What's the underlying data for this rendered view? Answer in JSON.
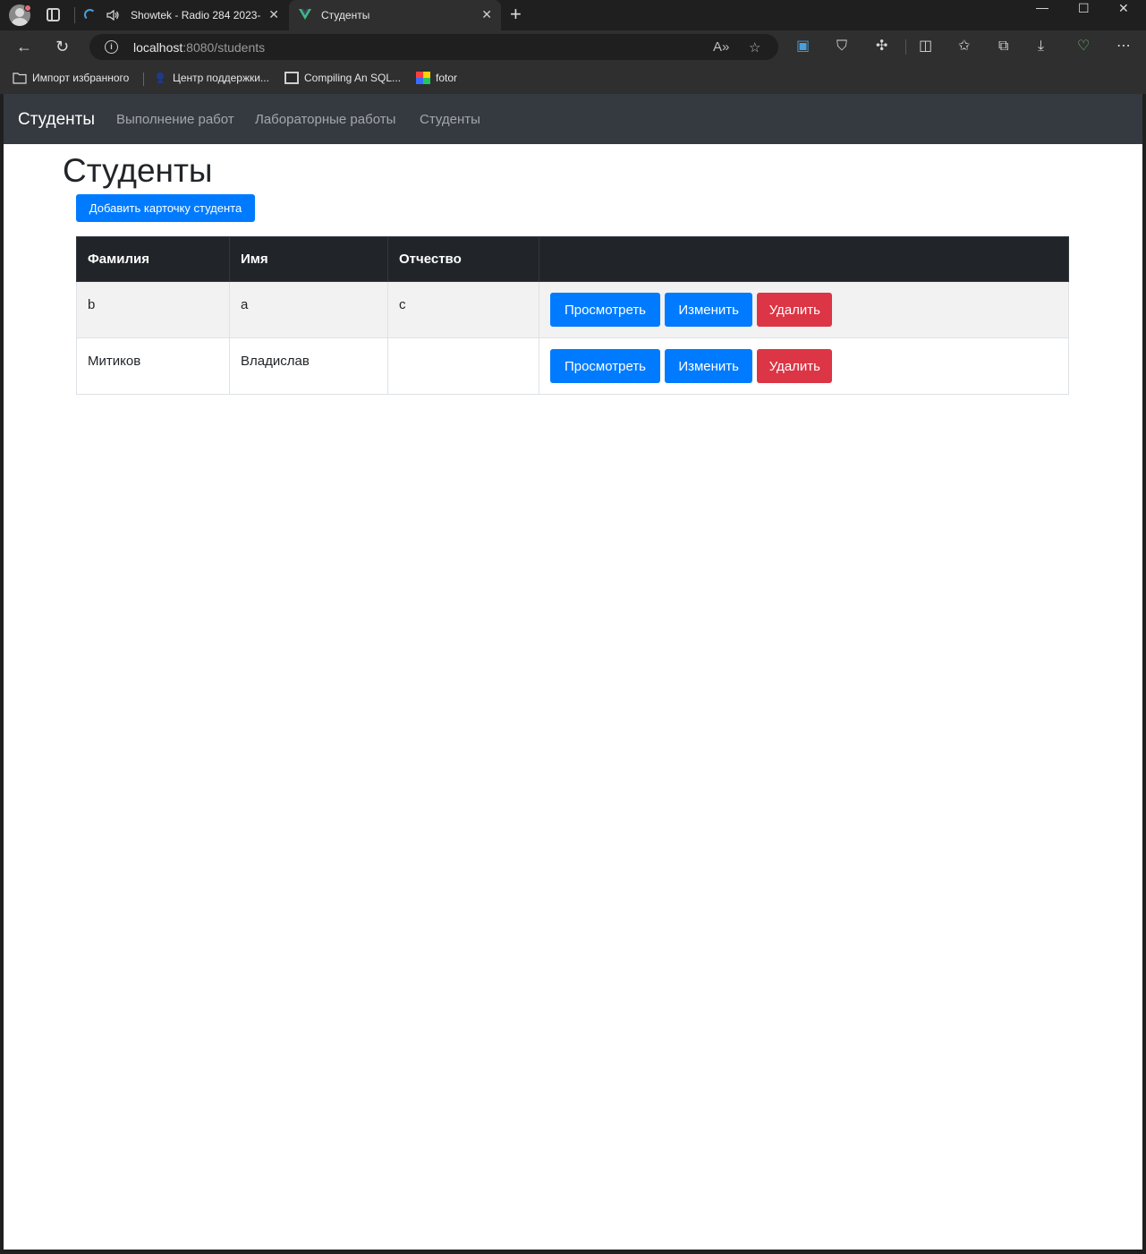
{
  "browser": {
    "tabs": [
      {
        "title": "Showtek - Radio 284 2023-",
        "active": false
      },
      {
        "title": "Студенты",
        "active": true
      }
    ],
    "address": {
      "host": "localhost",
      "rest": ":8080/students"
    },
    "favorites": [
      {
        "label": "Импорт избранного",
        "icon": "folder-import-icon"
      },
      {
        "label": "Центр поддержки...",
        "icon": "support-icon"
      },
      {
        "label": "Compiling An SQL...",
        "icon": "sql-icon"
      },
      {
        "label": "fotor",
        "icon": "fotor-icon"
      }
    ]
  },
  "navbar": {
    "brand": "Студенты",
    "links": [
      "Выполнение работ",
      "Лабораторные работы",
      "Студенты"
    ]
  },
  "page": {
    "title": "Студенты",
    "add_button": "Добавить карточку студента"
  },
  "table": {
    "headers": [
      "Фамилия",
      "Имя",
      "Отчество",
      ""
    ],
    "rows": [
      {
        "last_name": "b",
        "first_name": "a",
        "patronymic": "c"
      },
      {
        "last_name": "Митиков",
        "first_name": "Владислав",
        "patronymic": ""
      }
    ],
    "actions": {
      "view": "Просмотреть",
      "edit": "Изменить",
      "delete": "Удалить"
    }
  },
  "colors": {
    "primary": "#007bff",
    "danger": "#dc3545",
    "navbar": "#343a40",
    "table_header": "#212529"
  }
}
